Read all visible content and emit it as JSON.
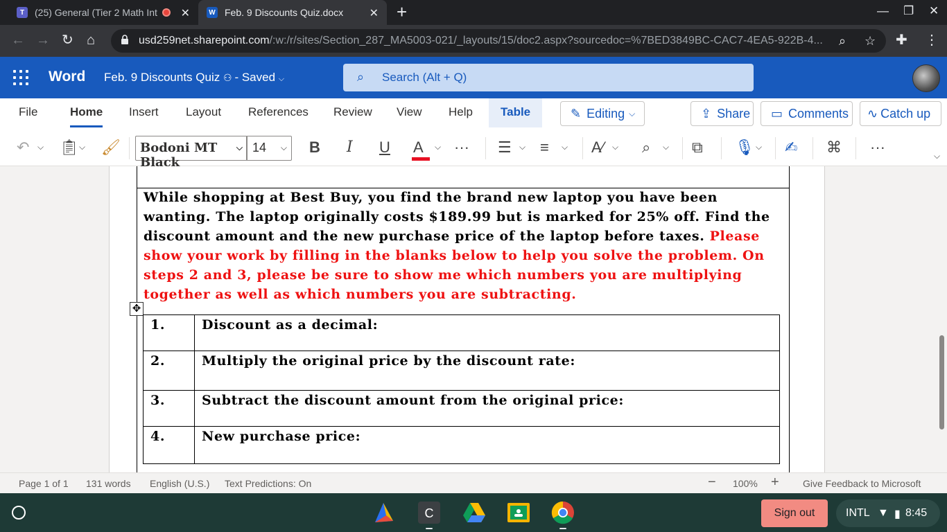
{
  "browser": {
    "tabs": [
      {
        "title": "(25) General (Tier 2 Math Int",
        "active": false
      },
      {
        "title": "Feb. 9 Discounts Quiz.docx",
        "active": true
      }
    ],
    "url_host": "usd259net.sharepoint.com",
    "url_path": "/:w:/r/sites/Section_287_MA5003-021/_layouts/15/doc2.aspx?sourcedoc=%7BED3849BC-CAC7-4EA5-922B-4..."
  },
  "word": {
    "app_name": "Word",
    "doc_title": "Feb. 9 Discounts Quiz",
    "save_status": "Saved",
    "search_placeholder": "Search (Alt + Q)"
  },
  "ribbon_tabs": [
    "File",
    "Home",
    "Insert",
    "Layout",
    "References",
    "Review",
    "View",
    "Help",
    "Table"
  ],
  "ribbon_buttons": {
    "editing": "Editing",
    "share": "Share",
    "comments": "Comments",
    "catch_up": "Catch up"
  },
  "format": {
    "font_name": "Bodoni MT Black",
    "font_size": "14",
    "accent_color": "#185abd",
    "font_color_bar": "#e81123"
  },
  "document": {
    "problem_black": "While shopping at Best Buy, you find the brand new laptop you have been wanting. The laptop originally costs $189.99 but is marked for 25% off. Find the discount amount and the new purchase price of the laptop before taxes. ",
    "problem_red": "Please show your work by filling in the blanks below to help you solve the problem. On steps 2 and 3, please be sure to show me which numbers you are multiplying together as well as which numbers you are subtracting.",
    "steps": [
      {
        "num": "1.",
        "text": "Discount as a decimal:"
      },
      {
        "num": "2.",
        "text": "Multiply the original price by the discount rate:"
      },
      {
        "num": "3.",
        "text": "Subtract the discount amount from the original price:"
      },
      {
        "num": "4.",
        "text": "New purchase price:"
      }
    ]
  },
  "status": {
    "page": "Page 1 of 1",
    "words": "131 words",
    "language": "English (U.S.)",
    "predictions": "Text Predictions: On",
    "zoom": "100%",
    "feedback": "Give Feedback to Microsoft"
  },
  "shelf": {
    "sign_out": "Sign out",
    "input_method": "INTL",
    "time": "8:45"
  }
}
